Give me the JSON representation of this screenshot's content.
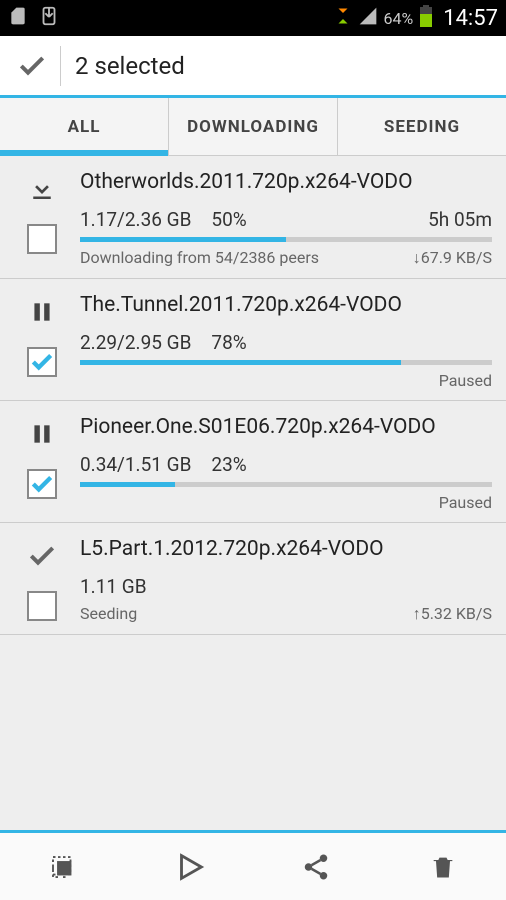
{
  "statusbar": {
    "battery_pct": "64%",
    "time": "14:57"
  },
  "actionbar": {
    "title": "2 selected"
  },
  "tabs": {
    "all": "ALL",
    "downloading": "DOWNLOADING",
    "seeding": "SEEDING",
    "active": "all"
  },
  "items": [
    {
      "title": "Otherworlds.2011.720p.x264-VODO",
      "size": "1.17/2.36 GB",
      "pct": "50%",
      "eta": "5h 05m",
      "status": "Downloading from 54/2386 peers",
      "speed": "↓67.9 KB/S",
      "progress": 50,
      "state_icon": "download",
      "checked": false,
      "show_progress": true
    },
    {
      "title": "The.Tunnel.2011.720p.x264-VODO",
      "size": "2.29/2.95 GB",
      "pct": "78%",
      "eta": "",
      "status": "",
      "speed": "Paused",
      "progress": 78,
      "state_icon": "pause",
      "checked": true,
      "show_progress": true
    },
    {
      "title": "Pioneer.One.S01E06.720p.x264-VODO",
      "size": "0.34/1.51 GB",
      "pct": "23%",
      "eta": "",
      "status": "",
      "speed": "Paused",
      "progress": 23,
      "state_icon": "pause",
      "checked": true,
      "show_progress": true
    },
    {
      "title": "L5.Part.1.2012.720p.x264-VODO",
      "size": "1.11 GB",
      "pct": "",
      "eta": "",
      "status": "Seeding",
      "speed": "↑5.32 KB/S",
      "progress": 0,
      "state_icon": "done",
      "checked": false,
      "show_progress": false
    }
  ]
}
